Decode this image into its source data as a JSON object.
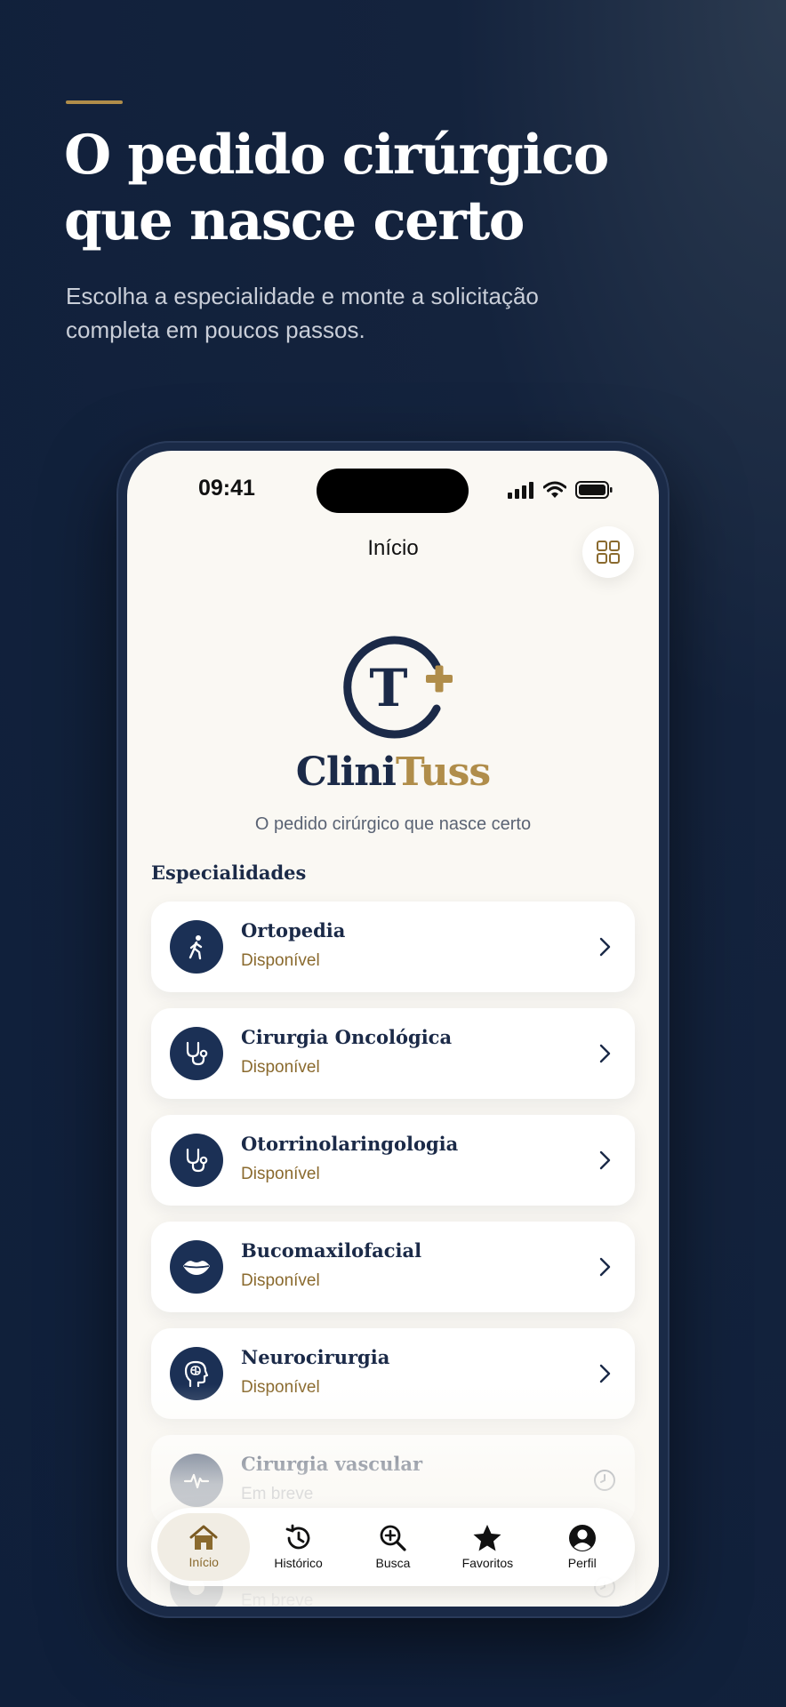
{
  "marketing": {
    "headline": "O pedido cirúrgico que nasce certo",
    "subheadline": "Escolha a especialidade e monte a solicitação completa em poucos passos."
  },
  "status_bar": {
    "time": "09:41"
  },
  "screen": {
    "title": "Início",
    "grid_icon": "grid-icon",
    "brand_part1": "Clini",
    "brand_part2": "Tuss",
    "logo_letter": "T",
    "tagline": "O pedido cirúrgico que nasce certo",
    "section_title": "Especialidades"
  },
  "specialties": [
    {
      "name": "Ortopedia",
      "status": "Disponível",
      "icon": "walking-person-icon",
      "action": "chevron-right-icon"
    },
    {
      "name": "Cirurgia Oncológica",
      "status": "Disponível",
      "icon": "stethoscope-icon",
      "action": "chevron-right-icon"
    },
    {
      "name": "Otorrinolaringologia",
      "status": "Disponível",
      "icon": "stethoscope-icon",
      "action": "chevron-right-icon"
    },
    {
      "name": "Bucomaxilofacial",
      "status": "Disponível",
      "icon": "lips-icon",
      "action": "chevron-right-icon"
    },
    {
      "name": "Neurocirurgia",
      "status": "Disponível",
      "icon": "brain-head-icon",
      "action": "chevron-right-icon"
    },
    {
      "name": "Cirurgia vascular",
      "status": "Em breve",
      "icon": "pulse-icon",
      "action": "clock-icon"
    },
    {
      "name": "",
      "status": "Em breve",
      "icon": "circle-icon",
      "action": "clock-icon"
    }
  ],
  "tabs": [
    {
      "label": "Início",
      "icon": "home-icon",
      "active": true
    },
    {
      "label": "Histórico",
      "icon": "history-icon",
      "active": false
    },
    {
      "label": "Busca",
      "icon": "search-plus-icon",
      "active": false
    },
    {
      "label": "Favoritos",
      "icon": "star-icon",
      "active": false
    },
    {
      "label": "Perfil",
      "icon": "profile-icon",
      "active": false
    }
  ],
  "colors": {
    "navy": "#1b2a48",
    "gold": "#b08d4a",
    "background": "#0f1f3a",
    "screen": "#faf8f3"
  }
}
